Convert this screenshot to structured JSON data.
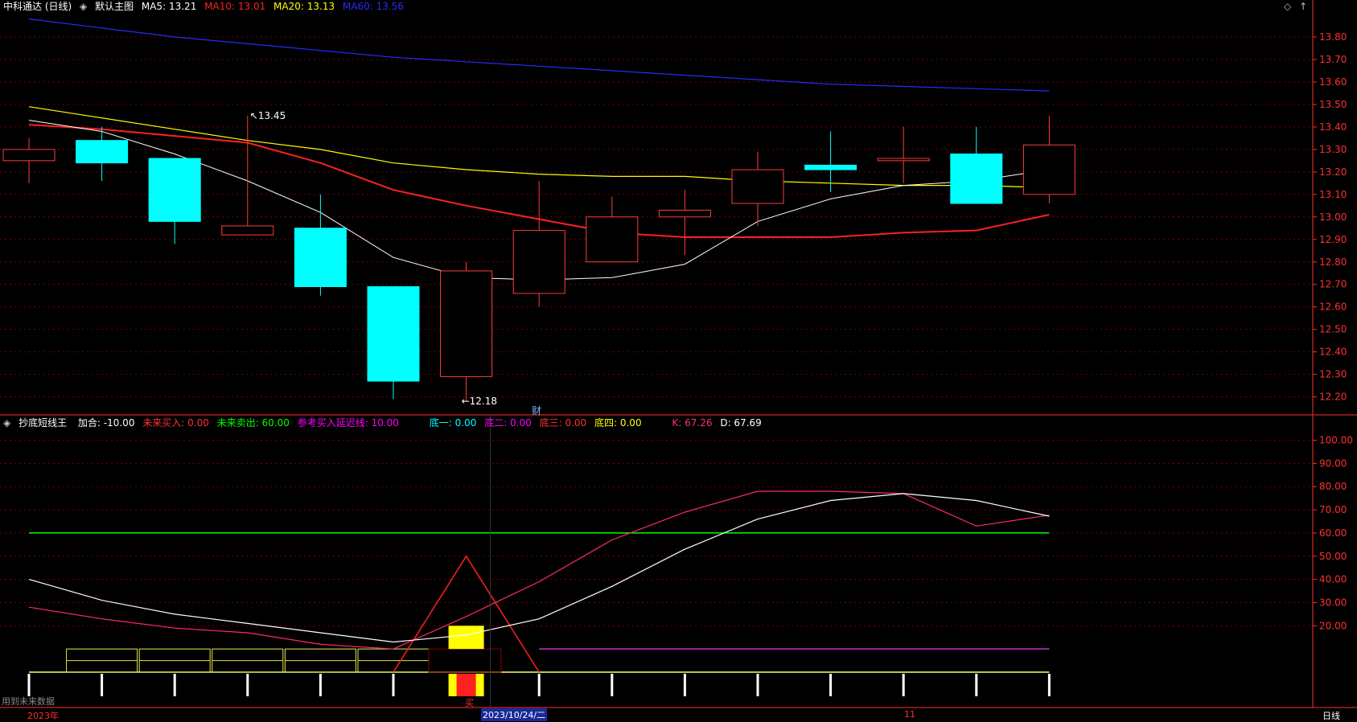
{
  "header": {
    "stock": "中科通达 (日线)",
    "template": "默认主图",
    "ma5": "MA5: 13.21",
    "ma10": "MA10: 13.01",
    "ma20": "MA20: 13.13",
    "ma60": "MA60: 13.56"
  },
  "colors": {
    "up": "#ff3b3b",
    "down": "#00ffff",
    "ma5": "#ffffff",
    "ma10": "#ff2020",
    "ma20": "#ffff00",
    "ma60": "#2a2aff",
    "grid": "#7a0000",
    "axis": "#ff3030"
  },
  "indicator": {
    "name": "抄底短线王",
    "jiahe": "加合: -10.00",
    "wlmr": "未来买入: 0.00",
    "wlmc": "未来卖出: 60.00",
    "ckmr": "参考买入延迟线: 10.00",
    "di1": "底一: 0.00",
    "di2": "底二: 0.00",
    "di3": "底三: 0.00",
    "di4": "底四: 0.00",
    "k": "K: 67.26",
    "d": "D: 67.69"
  },
  "footer": {
    "note": "用到未来数据",
    "year": "2023年",
    "date": "2023/10/24/二",
    "month": "11",
    "period": "日线"
  },
  "marker_cai": "财",
  "marker_buy": "买",
  "chart_data": [
    {
      "type": "candlestick",
      "title": "中科通达 (日线)",
      "yticks": [
        13.8,
        13.7,
        13.6,
        13.5,
        13.4,
        13.3,
        13.2,
        13.1,
        13.0,
        12.9,
        12.8,
        12.7,
        12.6,
        12.5,
        12.4,
        12.3,
        12.2
      ],
      "ylim": [
        12.12,
        13.9
      ],
      "candles": [
        {
          "o": 13.25,
          "h": 13.35,
          "l": 13.15,
          "c": 13.3
        },
        {
          "o": 13.34,
          "h": 13.4,
          "l": 13.16,
          "c": 13.24
        },
        {
          "o": 13.26,
          "h": 13.26,
          "l": 12.88,
          "c": 12.98
        },
        {
          "o": 12.92,
          "h": 13.45,
          "l": 12.92,
          "c": 12.96
        },
        {
          "o": 12.95,
          "h": 13.1,
          "l": 12.65,
          "c": 12.69
        },
        {
          "o": 12.69,
          "h": 12.69,
          "l": 12.19,
          "c": 12.27
        },
        {
          "o": 12.29,
          "h": 12.8,
          "l": 12.18,
          "c": 12.76
        },
        {
          "o": 12.66,
          "h": 13.16,
          "l": 12.6,
          "c": 12.94
        },
        {
          "o": 12.8,
          "h": 13.09,
          "l": 12.8,
          "c": 13.0
        },
        {
          "o": 13.0,
          "h": 13.12,
          "l": 12.83,
          "c": 13.03
        },
        {
          "o": 13.06,
          "h": 13.29,
          "l": 12.96,
          "c": 13.21
        },
        {
          "o": 13.23,
          "h": 13.38,
          "l": 13.11,
          "c": 13.21
        },
        {
          "o": 13.25,
          "h": 13.4,
          "l": 13.15,
          "c": 13.26
        },
        {
          "o": 13.28,
          "h": 13.4,
          "l": 13.06,
          "c": 13.06
        },
        {
          "o": 13.1,
          "h": 13.45,
          "l": 13.06,
          "c": 13.32
        }
      ],
      "ma5": [
        13.43,
        13.38,
        13.28,
        13.16,
        13.02,
        12.82,
        12.73,
        12.72,
        12.73,
        12.79,
        12.98,
        13.08,
        13.14,
        13.16,
        13.21
      ],
      "ma10": [
        13.41,
        13.39,
        13.36,
        13.33,
        13.24,
        13.12,
        13.05,
        12.99,
        12.93,
        12.91,
        12.91,
        12.91,
        12.93,
        12.94,
        13.01
      ],
      "ma20": [
        13.49,
        13.44,
        13.39,
        13.34,
        13.3,
        13.24,
        13.21,
        13.19,
        13.18,
        13.18,
        13.16,
        13.15,
        13.14,
        13.14,
        13.13
      ],
      "ma60": [
        13.88,
        13.84,
        13.8,
        13.77,
        13.74,
        13.71,
        13.69,
        13.67,
        13.65,
        13.63,
        13.61,
        13.59,
        13.58,
        13.57,
        13.56
      ],
      "annotations": {
        "high": "13.45",
        "low": "12.18"
      }
    },
    {
      "type": "line",
      "title": "抄底短线王",
      "yticks": [
        100,
        90,
        80,
        70,
        60,
        50,
        40,
        30,
        20
      ],
      "ylim": [
        0,
        104
      ],
      "k": [
        40,
        31,
        25,
        21,
        17,
        13,
        16,
        23,
        37,
        53,
        66,
        74,
        77,
        74,
        67.26
      ],
      "d": [
        28,
        23,
        19,
        17,
        12,
        10,
        24,
        39,
        57,
        69,
        78,
        78,
        77,
        63,
        67.69
      ],
      "peak_line": [
        null,
        null,
        null,
        null,
        null,
        0,
        50,
        0
      ],
      "sell_line": 60,
      "ref_line": 10
    }
  ]
}
